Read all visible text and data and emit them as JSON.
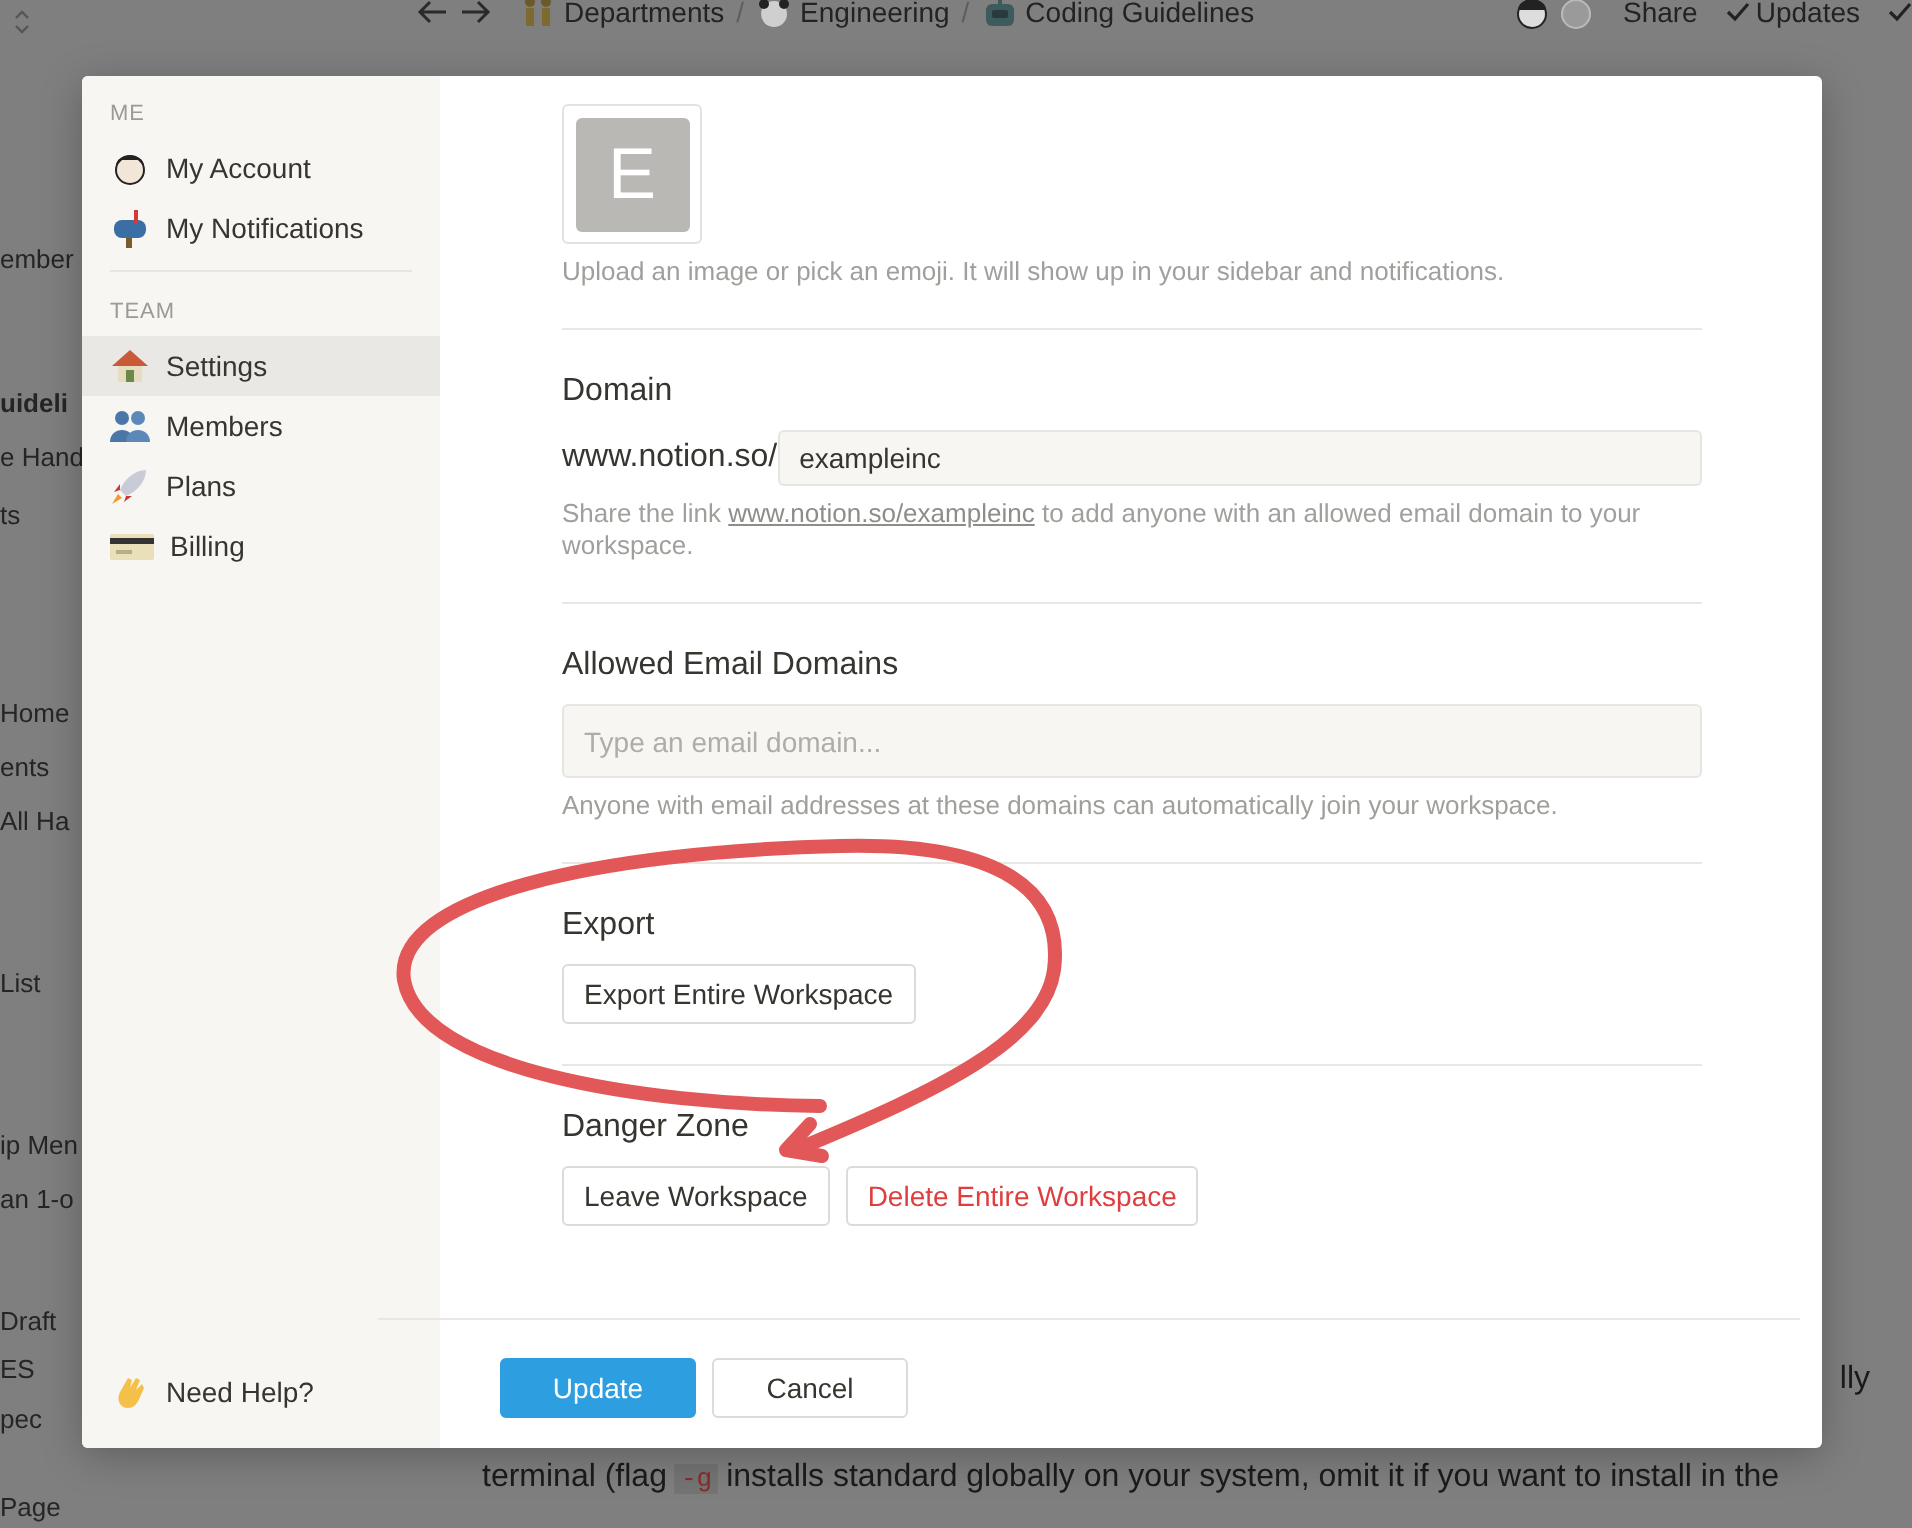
{
  "topbar": {
    "separator": "/",
    "breadcrumbs": [
      {
        "label": "Departments"
      },
      {
        "label": "Engineering"
      },
      {
        "label": "Coding Guidelines"
      }
    ],
    "actions": [
      {
        "label": "Share",
        "kind": "plain"
      },
      {
        "label": "Updates",
        "kind": "check"
      }
    ]
  },
  "background_sidebar": {
    "items": [
      {
        "label": "ember",
        "selected": false
      },
      {
        "label": "uideli",
        "selected": true
      },
      {
        "label": "e Hand",
        "selected": false
      },
      {
        "label": "ts",
        "selected": false
      },
      {
        "label": "Home",
        "selected": false
      },
      {
        "label": "ents",
        "selected": false
      },
      {
        "label": "All Ha",
        "selected": false
      },
      {
        "label": "List",
        "selected": false
      },
      {
        "label": "ip Men",
        "selected": false
      },
      {
        "label": "an 1-o",
        "selected": false
      },
      {
        "label": "Draft",
        "selected": false
      },
      {
        "label": "ES",
        "selected": false
      },
      {
        "label": "pec",
        "selected": false
      },
      {
        "label": "Page",
        "selected": false
      }
    ]
  },
  "background_page": {
    "lines": [
      {
        "kind": "tail",
        "text": "lly"
      },
      {
        "kind": "code",
        "before": "terminal (flag",
        "code": "-g",
        "after": "installs standard globally on your system, omit it if you want to install in the"
      }
    ]
  },
  "settings_modal": {
    "sidebar": {
      "sections": [
        {
          "heading": "ME",
          "items": [
            {
              "label": "My Account",
              "selected": false
            },
            {
              "label": "My Notifications",
              "selected": false
            }
          ]
        },
        {
          "heading": "TEAM",
          "items": [
            {
              "label": "Settings",
              "selected": true
            },
            {
              "label": "Members",
              "selected": false
            },
            {
              "label": "Plans",
              "selected": false
            },
            {
              "label": "Billing",
              "selected": false
            }
          ]
        }
      ],
      "help": {
        "label": "Need Help?"
      }
    },
    "workspace_icon": {
      "letter": "E",
      "caption": "Upload an image or pick an emoji. It will show up in your sidebar and notifications."
    },
    "domain": {
      "title": "Domain",
      "prefix": "www.notion.so/",
      "value": "exampleinc",
      "help_before": "Share the link",
      "help_link": "www.notion.so/exampleinc",
      "help_after": "to add anyone with an allowed email domain to your workspace."
    },
    "allowed_email_domains": {
      "title": "Allowed Email Domains",
      "placeholder": "Type an email domain...",
      "help": "Anyone with email addresses at these domains can automatically join your workspace."
    },
    "export": {
      "title": "Export",
      "buttons": [
        {
          "label": "Export Entire Workspace",
          "kind": "default"
        }
      ]
    },
    "danger_zone": {
      "title": "Danger Zone",
      "buttons": [
        {
          "label": "Leave Workspace",
          "kind": "default"
        },
        {
          "label": "Delete Entire Workspace",
          "kind": "danger"
        }
      ]
    },
    "footer": {
      "buttons": [
        {
          "label": "Update",
          "kind": "primary"
        },
        {
          "label": "Cancel",
          "kind": "default"
        }
      ]
    }
  }
}
